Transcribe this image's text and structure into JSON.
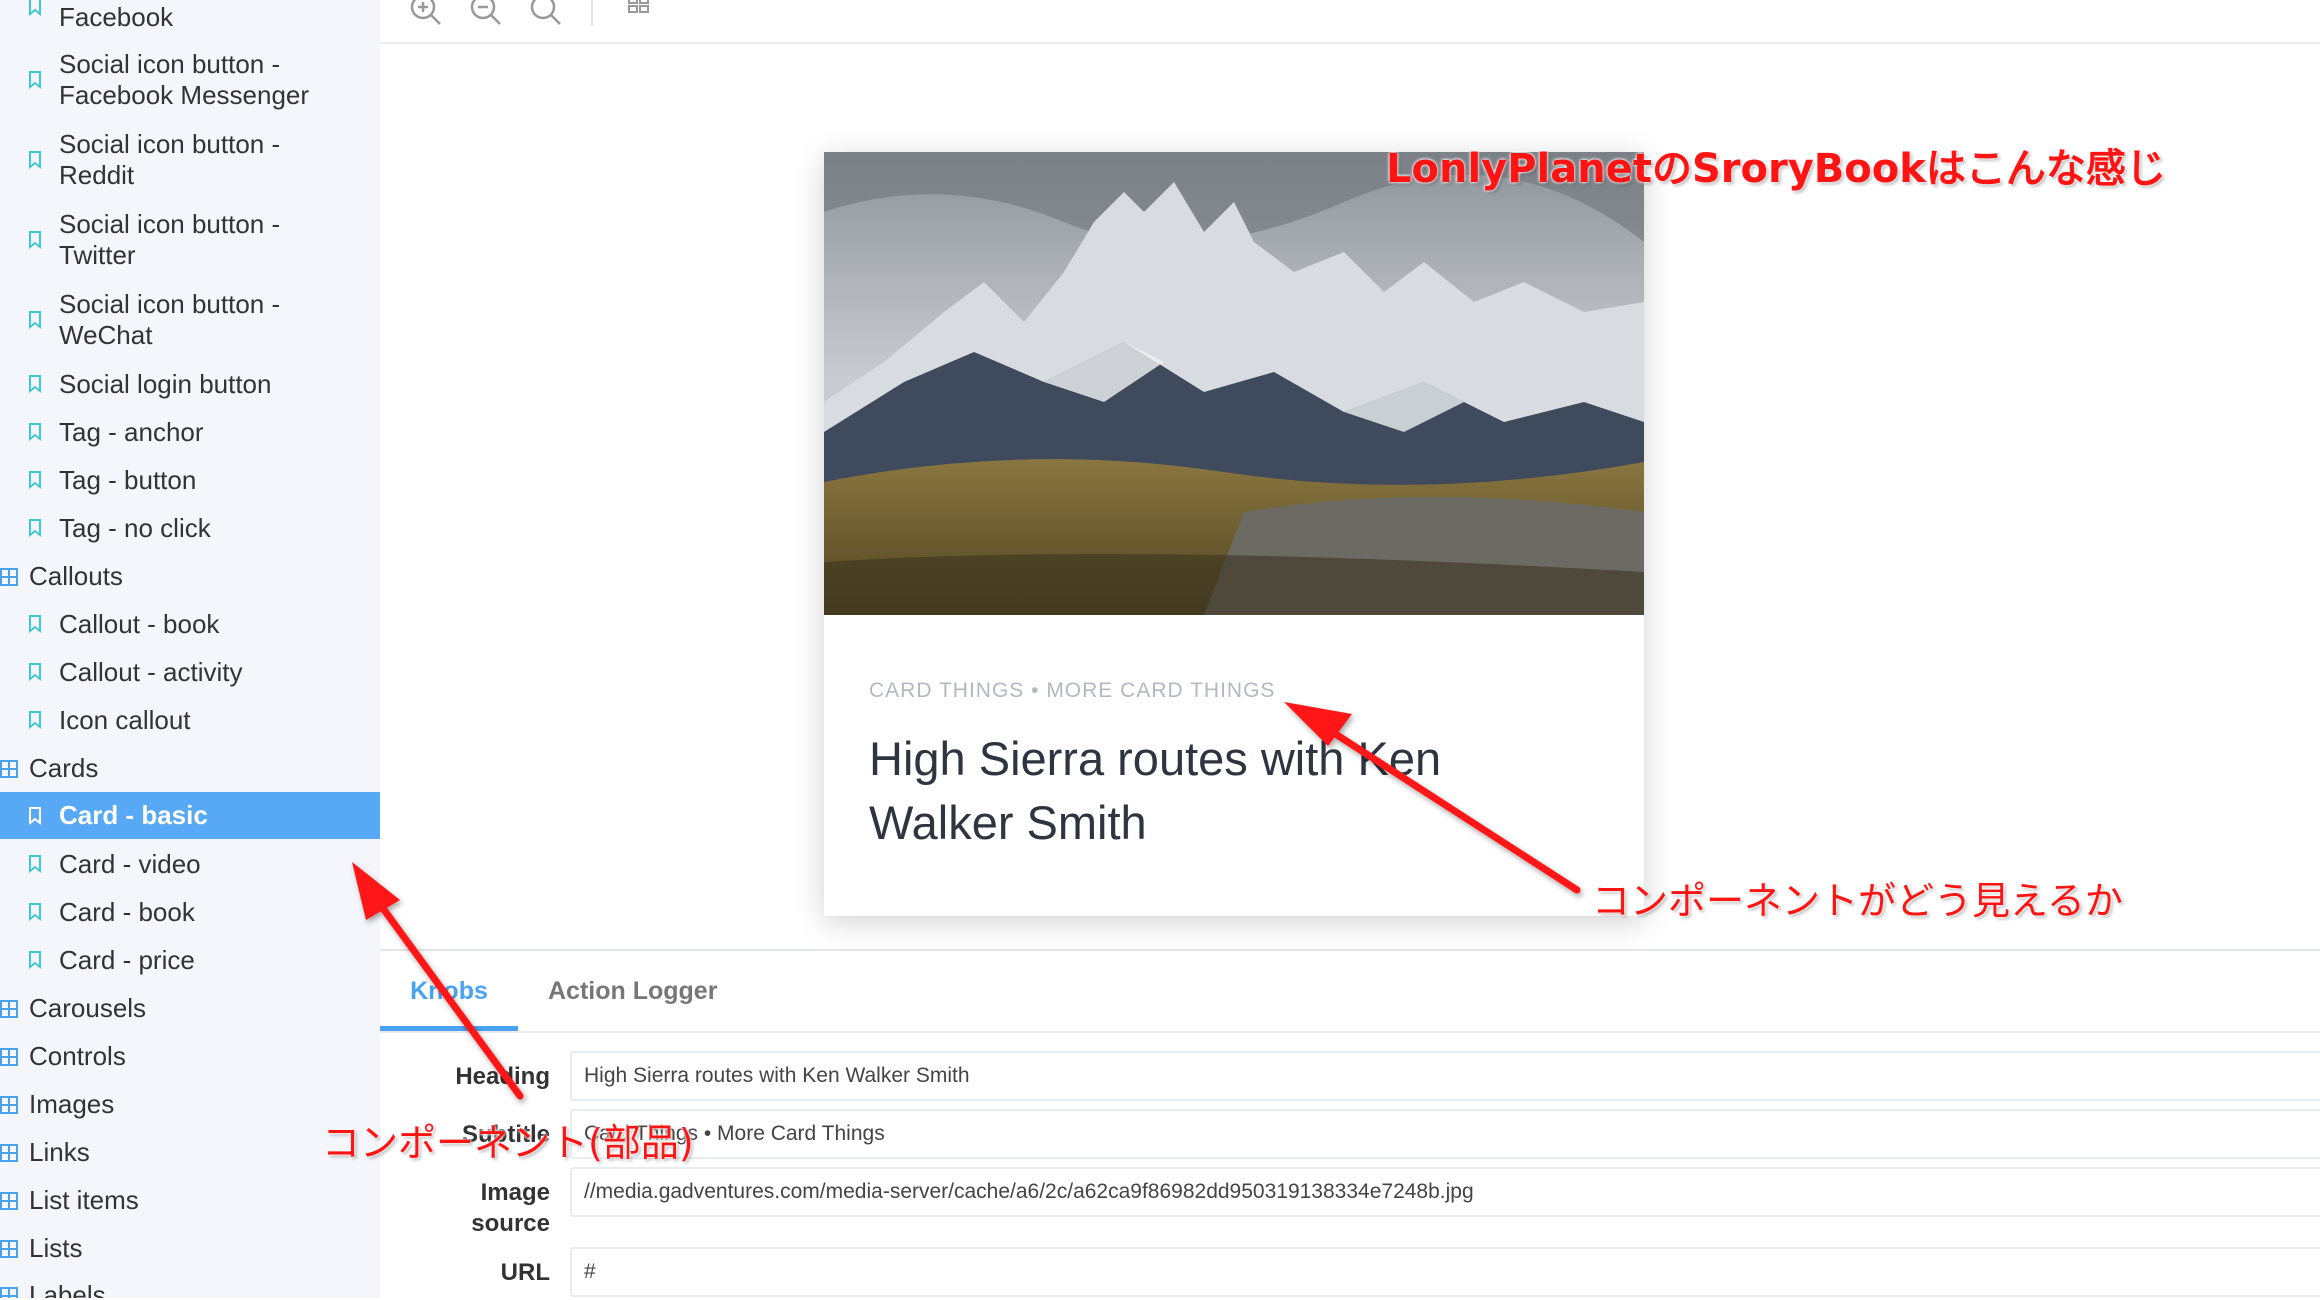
{
  "sidebar": {
    "rows": [
      {
        "label": "Facebook",
        "type": "item"
      },
      {
        "label": "Social icon button - Facebook Messenger",
        "line1": "Social icon button -",
        "line2": "Facebook Messenger",
        "type": "item"
      },
      {
        "label": "Social icon button - Reddit",
        "line1": "Social icon button -",
        "line2": "Reddit",
        "type": "item"
      },
      {
        "label": "Social icon button - Twitter",
        "line1": "Social icon button -",
        "line2": "Twitter",
        "type": "item"
      },
      {
        "label": "Social icon button - WeChat",
        "line1": "Social icon button -",
        "line2": "WeChat",
        "type": "item"
      },
      {
        "label": "Social login button",
        "type": "item"
      },
      {
        "label": "Tag - anchor",
        "type": "item"
      },
      {
        "label": "Tag - button",
        "type": "item"
      },
      {
        "label": "Tag - no click",
        "type": "item"
      },
      {
        "label": "Callouts",
        "type": "group"
      },
      {
        "label": "Callout - book",
        "type": "item"
      },
      {
        "label": "Callout - activity",
        "type": "item"
      },
      {
        "label": "Icon callout",
        "type": "item"
      },
      {
        "label": "Cards",
        "type": "group"
      },
      {
        "label": "Card - basic",
        "type": "item",
        "selected": true
      },
      {
        "label": "Card - video",
        "type": "item"
      },
      {
        "label": "Card - book",
        "type": "item"
      },
      {
        "label": "Card - price",
        "type": "item"
      },
      {
        "label": "Carousels",
        "type": "group"
      },
      {
        "label": "Controls",
        "type": "group"
      },
      {
        "label": "Images",
        "type": "group"
      },
      {
        "label": "Links",
        "type": "group"
      },
      {
        "label": "List items",
        "type": "group"
      },
      {
        "label": "Lists",
        "type": "group"
      },
      {
        "label": "Labels",
        "type": "group"
      }
    ]
  },
  "toolbar": {
    "icons": [
      "zoom-in-icon",
      "zoom-out-icon",
      "zoom-reset-icon",
      "grid-icon"
    ]
  },
  "card": {
    "subtitle": "CARD THINGS • MORE CARD THINGS",
    "title_line1": "High Sierra routes with Ken",
    "title_line2": "Walker Smith"
  },
  "addons": {
    "tabs": [
      {
        "label": "Knobs",
        "active": true
      },
      {
        "label": "Action Logger",
        "active": false
      }
    ],
    "knobs": [
      {
        "label": "Heading",
        "value": "High Sierra routes with Ken Walker Smith"
      },
      {
        "label": "Subtitle",
        "value": "Card Things • More Card Things"
      },
      {
        "label_line1": "Image",
        "label_line2": "source",
        "value": "//media.gadventures.com/media-server/cache/a6/2c/a62ca9f86982dd950319138334e7248b.jpg"
      },
      {
        "label": "URL",
        "value": "#"
      }
    ]
  },
  "annotations": {
    "top": "LonlyPlanetのSroryBookはこんな感じ",
    "right": "コンポーネントがどう見えるか",
    "bottom": "コンポーネント(部品)"
  },
  "colors": {
    "accent": "#58a9f5",
    "tab_active": "#4aa3f0",
    "annotation": "#ff1414",
    "sidebar_icon": "#3ec9cf"
  }
}
